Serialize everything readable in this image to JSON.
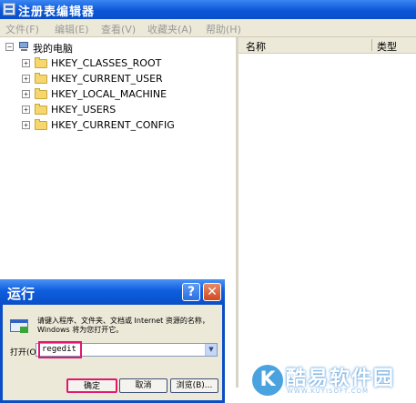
{
  "window": {
    "title": "注册表编辑器",
    "title_icon": "registry-icon"
  },
  "menu": [
    "文件(F)",
    "编辑(E)",
    "查看(V)",
    "收藏夹(A)",
    "帮助(H)"
  ],
  "tree": {
    "root": "我的电脑",
    "items": [
      "HKEY_CLASSES_ROOT",
      "HKEY_CURRENT_USER",
      "HKEY_LOCAL_MACHINE",
      "HKEY_USERS",
      "HKEY_CURRENT_CONFIG"
    ]
  },
  "list": {
    "columns": [
      "名称",
      "类型"
    ]
  },
  "run_dialog": {
    "title": "运行",
    "help_glyph": "?",
    "close_glyph": "✕",
    "description": "请键入程序、文件夹、文档或 Internet 资源的名称，Windows 将为您打开它。",
    "open_label": "打开(O):",
    "open_value": "regedit",
    "ok_label": "确定",
    "cancel_label": "取消",
    "browse_label": "浏览(B)...",
    "highlight_color": "#e0186f"
  },
  "watermark": {
    "logo_letter": "K",
    "text": "酷易软件园",
    "subtext": "WWW.KUYISOFT.COM"
  }
}
